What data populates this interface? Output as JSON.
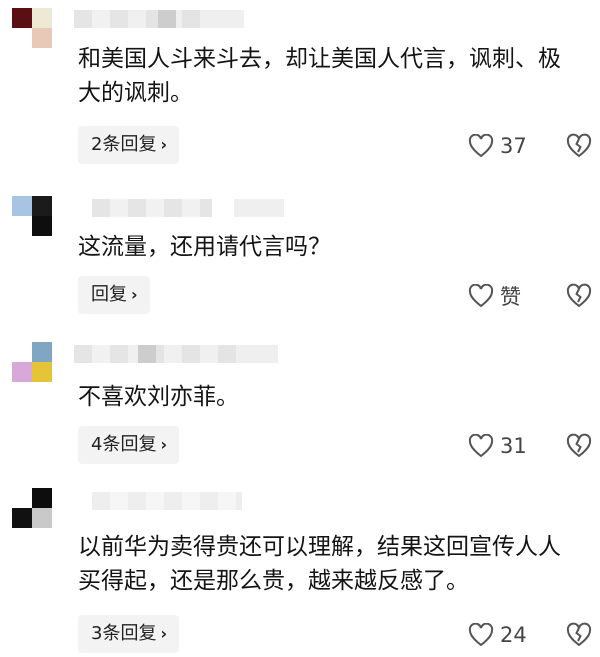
{
  "comments": [
    {
      "text": "和美国人斗来斗去，却让美国人代言，讽刺、极大的讽刺。",
      "reply_label": "2条回复",
      "like_count": "37"
    },
    {
      "text": "这流量，还用请代言吗？",
      "reply_label": "回复",
      "like_count": "赞"
    },
    {
      "text": "不喜欢刘亦菲。",
      "reply_label": "4条回复",
      "like_count": "31"
    },
    {
      "text": "以前华为卖得贵还可以理解，结果这回宣传人人买得起，还是那么贵，越来越反感了。",
      "reply_label": "3条回复",
      "like_count": "24"
    }
  ],
  "icons": {
    "like": "heart-icon",
    "dislike": "broken-heart-icon",
    "reply_chevron": "chevron-right-icon"
  },
  "colors": {
    "reply_bg": "#f3f3f3",
    "icon": "#555555"
  }
}
